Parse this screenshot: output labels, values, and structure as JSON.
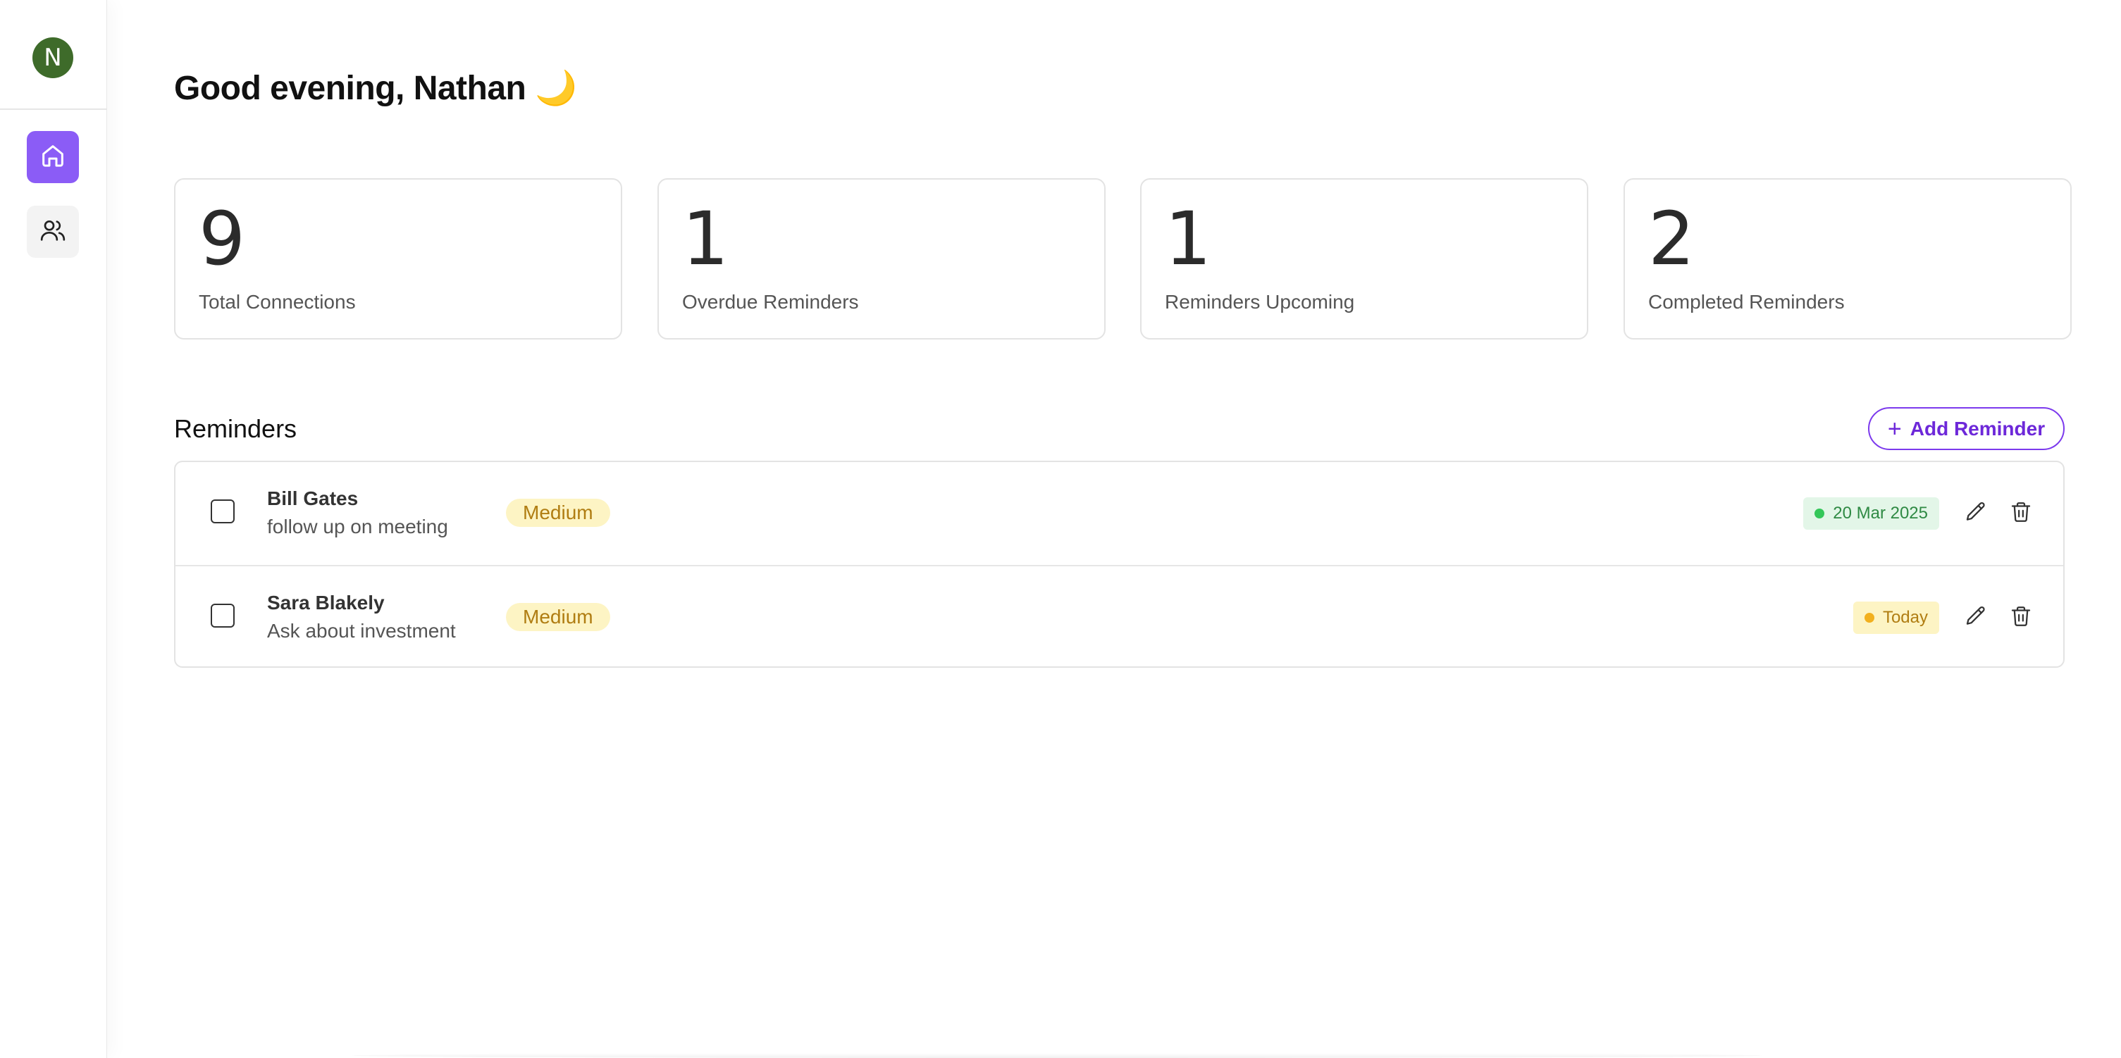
{
  "user": {
    "initial": "N"
  },
  "sidebar": {
    "items": [
      {
        "name": "home",
        "icon": "home-icon",
        "active": true
      },
      {
        "name": "connections",
        "icon": "users-icon",
        "active": false
      }
    ]
  },
  "header": {
    "greeting": "Good evening, Nathan 🌙"
  },
  "stats": [
    {
      "value": "9",
      "label": "Total Connections"
    },
    {
      "value": "1",
      "label": "Overdue Reminders"
    },
    {
      "value": "1",
      "label": "Reminders Upcoming"
    },
    {
      "value": "2",
      "label": "Completed Reminders"
    }
  ],
  "reminders": {
    "title": "Reminders",
    "add_label": "Add Reminder",
    "add_icon": "plus-icon",
    "items": [
      {
        "name": "Bill Gates",
        "note": "follow up on meeting",
        "priority": "Medium",
        "date": "20 Mar 2025",
        "date_status": "upcoming",
        "status_color": "#34c759"
      },
      {
        "name": "Sara Blakely",
        "note": "Ask about investment",
        "priority": "Medium",
        "date": "Today",
        "date_status": "today",
        "status_color": "#f2b01e"
      }
    ]
  },
  "colors": {
    "accent": "#8b5cf6",
    "accent_text": "#6d28d9",
    "avatar_bg": "#3e6b2a",
    "priority_bg": "#fdf4c4",
    "priority_text": "#b07d12"
  }
}
